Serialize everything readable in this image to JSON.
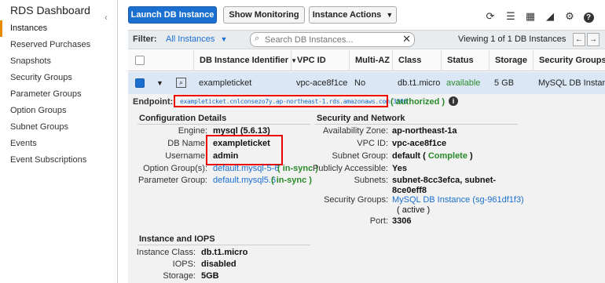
{
  "sidebar": {
    "title": "RDS Dashboard",
    "items": [
      "Instances",
      "Reserved Purchases",
      "Snapshots",
      "Security Groups",
      "Parameter Groups",
      "Option Groups",
      "Subnet Groups",
      "Events",
      "Event Subscriptions"
    ],
    "active": "Instances"
  },
  "toolbar": {
    "launch": "Launch DB Instance",
    "monitoring": "Show Monitoring",
    "actions": "Instance Actions",
    "icons": [
      "refresh-icon",
      "list-view-icon",
      "grid-view-icon",
      "chart-icon",
      "gear-icon",
      "help-icon"
    ]
  },
  "filter": {
    "label": "Filter:",
    "selected": "All Instances",
    "search_placeholder": "Search DB Instances...",
    "viewing": "Viewing 1 of 1 DB Instances"
  },
  "table": {
    "headers": [
      "DB Instance Identifier",
      "VPC ID",
      "Multi-AZ",
      "Class",
      "Status",
      "Storage",
      "Security Groups"
    ],
    "row": {
      "identifier": "exampleticket",
      "vpc": "vpc-ace8f1ce",
      "multi_az": "No",
      "class": "db.t1.micro",
      "status": "available",
      "storage": "5 GB",
      "security_groups": "MySQL DB Instanc"
    }
  },
  "detail": {
    "endpoint_label": "Endpoint:",
    "endpoint": "exampleticket.cnlconsezo7y.ap-northeast-1.rds.amazonaws.com:3306",
    "endpoint_status": "( authorized )",
    "config": {
      "title": "Configuration Details",
      "engine_label": "Engine:",
      "engine": "mysql (5.6.13)",
      "dbname_label": "DB Name:",
      "dbname": "exampleticket",
      "username_label": "Username:",
      "username": "admin",
      "option_label": "Option Group(s):",
      "option": "default.mysql-5-6",
      "option_status": "( in-sync )",
      "param_label": "Parameter Group:",
      "param": "default.mysql5.6",
      "param_status": "( in-sync )"
    },
    "security": {
      "title": "Security and Network",
      "az_label": "Availability Zone:",
      "az": "ap-northeast-1a",
      "vpc_label": "VPC ID:",
      "vpc": "vpc-ace8f1ce",
      "subnet_group_label": "Subnet Group:",
      "subnet_group_prefix": "default (",
      "subnet_group_status": "Complete",
      "subnet_group_suffix": ")",
      "public_label": "Publicly Accessible:",
      "public": "Yes",
      "subnets_label": "Subnets:",
      "subnets_1": "subnet-8cc3efca, subnet-",
      "subnets_2": "8ce0eff8",
      "sg_label": "Security Groups:",
      "sg": "MySQL DB Instance (sg-961df1f3)",
      "sg_status": "( active )",
      "port_label": "Port:",
      "port": "3306"
    },
    "iops": {
      "title": "Instance and IOPS",
      "class_label": "Instance Class:",
      "class": "db.t1.micro",
      "iops_label": "IOPS:",
      "iops": "disabled",
      "storage_label": "Storage:",
      "storage": "5GB"
    }
  },
  "colors": {
    "primary": "#1a6fd0",
    "highlight": "#e00000",
    "ok": "#2a8a2a",
    "active_tab": "#e68a00"
  }
}
